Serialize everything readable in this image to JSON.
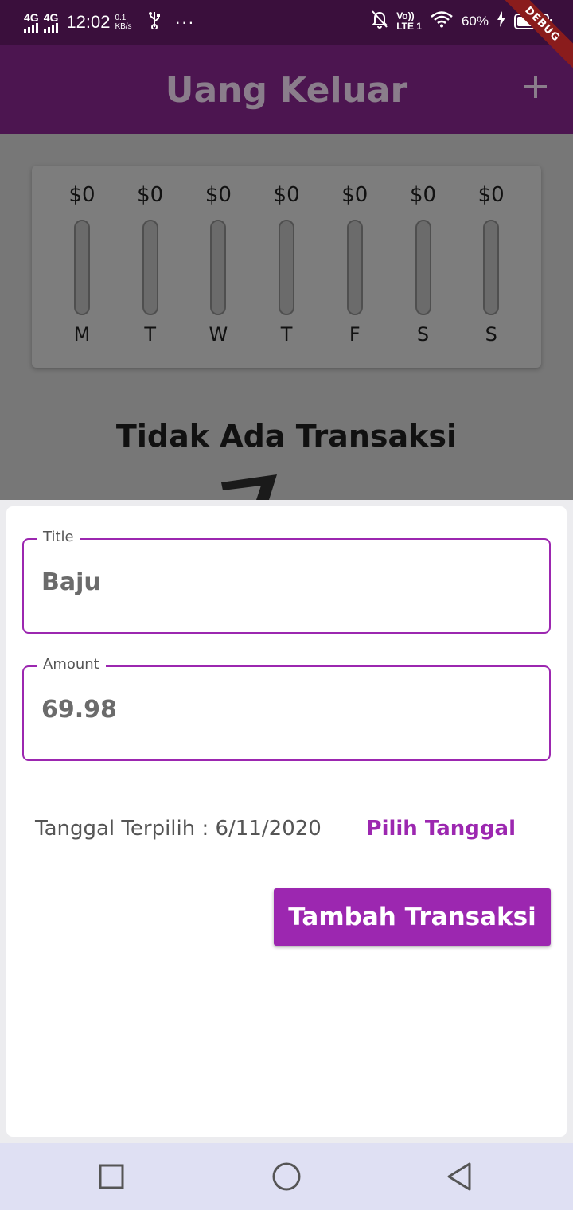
{
  "status_bar": {
    "network_1": "4G",
    "network_2": "4G",
    "time": "12:02",
    "speed_value": "0.1",
    "speed_unit": "KB/s",
    "usb_icon": "usb-icon",
    "more": "···",
    "volte_top": "Vo))",
    "volte_bottom": "LTE 1",
    "battery_percent": "60%",
    "battery_level": 0.6
  },
  "debug_banner": "DEBUG",
  "app_bar": {
    "title": "Uang Keluar",
    "add_icon": "plus-icon"
  },
  "chart_data": {
    "type": "bar",
    "categories": [
      "M",
      "T",
      "W",
      "T",
      "F",
      "S",
      "S"
    ],
    "values": [
      0,
      0,
      0,
      0,
      0,
      0,
      0
    ],
    "labels": [
      "$0",
      "$0",
      "$0",
      "$0",
      "$0",
      "$0",
      "$0"
    ],
    "title": "",
    "xlabel": "",
    "ylabel": ""
  },
  "empty_state": {
    "text": "Tidak Ada Transaksi"
  },
  "form": {
    "title_label": "Title",
    "title_value": "Baju",
    "amount_label": "Amount",
    "amount_value": "69.98",
    "date_text": "Tanggal Terpilih : 6/11/2020",
    "pick_date_label": "Pilih Tanggal",
    "submit_label": "Tambah Transaksi"
  },
  "nav_bar": {
    "recents_icon": "square-icon",
    "home_icon": "circle-icon",
    "back_icon": "triangle-back-icon"
  },
  "colors": {
    "primary": "#9c27b0",
    "app_bar": "#4c1550",
    "status_bar": "#3a0f3c",
    "scrim": "#777777",
    "nav_bar": "#dfe0f3"
  }
}
